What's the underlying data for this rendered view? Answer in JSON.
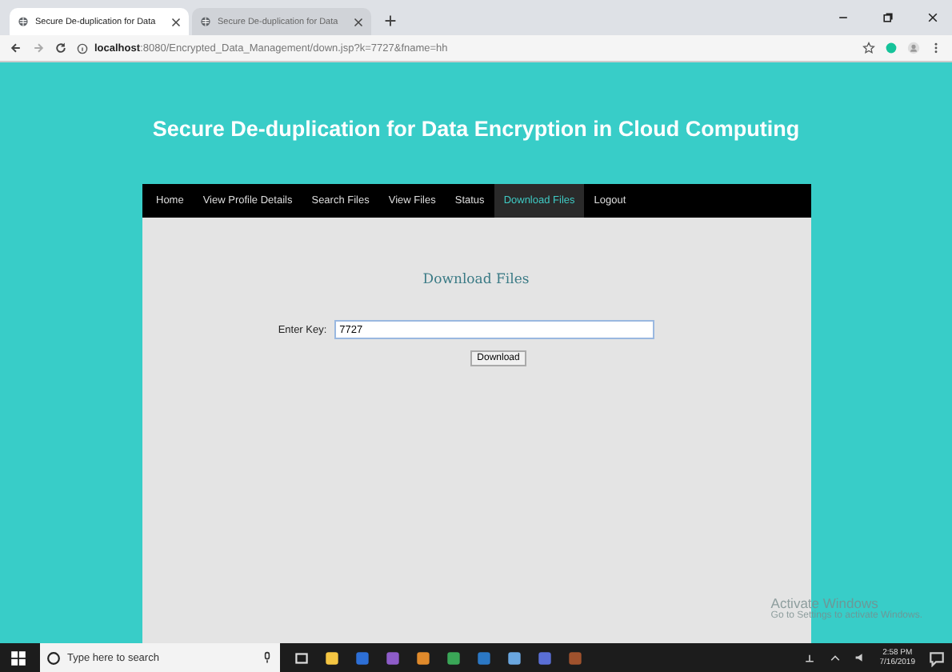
{
  "browser": {
    "tabs": [
      {
        "title": "Secure De-duplication for Data",
        "selected": true
      },
      {
        "title": "Secure De-duplication for Data",
        "selected": false
      }
    ],
    "url_host": "localhost",
    "url_rest": ":8080/Encrypted_Data_Management/down.jsp?k=7727&fname=hh"
  },
  "page": {
    "title": "Secure De-duplication for Data Encryption in Cloud Computing",
    "nav": [
      {
        "label": "Home",
        "selected": false
      },
      {
        "label": "View Profile Details",
        "selected": false
      },
      {
        "label": "Search Files",
        "selected": false
      },
      {
        "label": "View Files",
        "selected": false
      },
      {
        "label": "Status",
        "selected": false
      },
      {
        "label": "Download Files",
        "selected": true
      },
      {
        "label": "Logout",
        "selected": false
      }
    ],
    "heading": "Download Files",
    "key_label": "Enter Key:",
    "key_value": "7727",
    "button": "Download"
  },
  "activation": {
    "title": "Activate Windows",
    "text": "Go to Settings to activate Windows."
  },
  "taskbar": {
    "search_placeholder": "Type here to search",
    "time": "2:58 PM",
    "date": "7/16/2019"
  }
}
